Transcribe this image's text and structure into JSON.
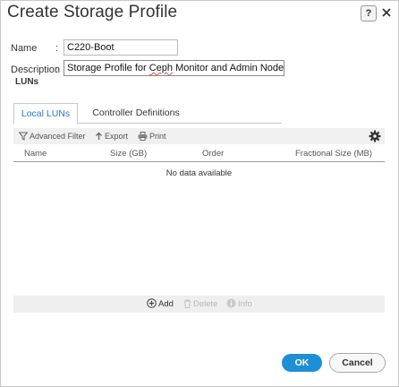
{
  "dialog": {
    "title": "Create Storage Profile",
    "help_label": "?"
  },
  "form": {
    "name_label": "Name",
    "name_colon": ":",
    "name_value": "C220-Boot",
    "description_label": "Description",
    "description_colon": ":",
    "description_before": "Storage Profile for ",
    "description_word": "Ceph",
    "description_after": " Monitor and Admin Nodes"
  },
  "luns": {
    "section_title": "LUNs",
    "tabs": [
      {
        "label": "Local LUNs",
        "active": true
      },
      {
        "label": "Controller Definitions",
        "active": false
      }
    ],
    "toolbar": {
      "advanced_filter": "Advanced Filter",
      "export": "Export",
      "print": "Print",
      "settings_icon": "gear-icon"
    },
    "columns": [
      "Name",
      "Size (GB)",
      "Order",
      "Fractional Size (MB)"
    ],
    "empty_message": "No data available",
    "actions": {
      "add": "Add",
      "delete": "Delete",
      "info": "Info"
    }
  },
  "footer": {
    "ok_label": "OK",
    "cancel_label": "Cancel"
  },
  "colors": {
    "primary": "#1e8fd6",
    "active_tab_text": "#2a76c6",
    "disabled_text": "#b8b8b8"
  }
}
